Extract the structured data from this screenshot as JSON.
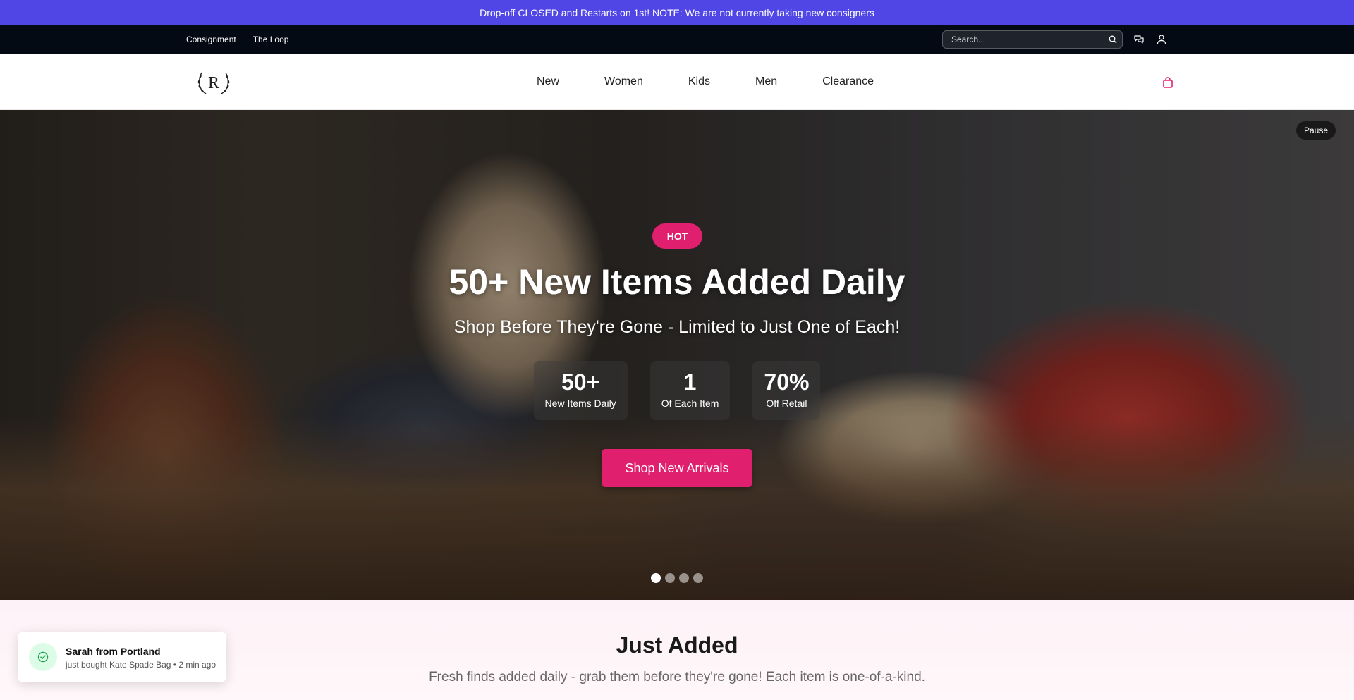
{
  "announcement": {
    "icon": "info-icon",
    "text": "Drop-off CLOSED and Restarts on 1st! NOTE: We are not currently taking new consigners"
  },
  "utility_nav": {
    "links": [
      "Consignment",
      "The Loop"
    ],
    "search_placeholder": "Search...",
    "icons": [
      "search-icon",
      "chat-icon",
      "user-icon"
    ]
  },
  "logo": {
    "letter": "R"
  },
  "main_nav": {
    "items": [
      "New",
      "Women",
      "Kids",
      "Men",
      "Clearance"
    ],
    "cart_icon": "shopping-bag-icon",
    "cart_color": "#e0206f"
  },
  "hero": {
    "pause_label": "Pause",
    "badge": "HOT",
    "title": "50+ New Items Added Daily",
    "subtitle": "Shop Before They're Gone - Limited to Just One of Each!",
    "stats": [
      {
        "value": "50+",
        "label": "New Items Daily"
      },
      {
        "value": "1",
        "label": "Of Each Item"
      },
      {
        "value": "70%",
        "label": "Off Retail"
      }
    ],
    "cta": "Shop New Arrivals",
    "slides": 4,
    "active_slide": 1
  },
  "just_added": {
    "title": "Just Added",
    "subtitle": "Fresh finds added daily - grab them before they're gone! Each item is one-of-a-kind."
  },
  "toast": {
    "name": "Sarah from Portland",
    "message": "just bought Kate Spade Bag • 2 min ago"
  },
  "colors": {
    "announcement_bg": "#4f46e5",
    "accent": "#e0206f",
    "utility_bg": "#030a14"
  }
}
